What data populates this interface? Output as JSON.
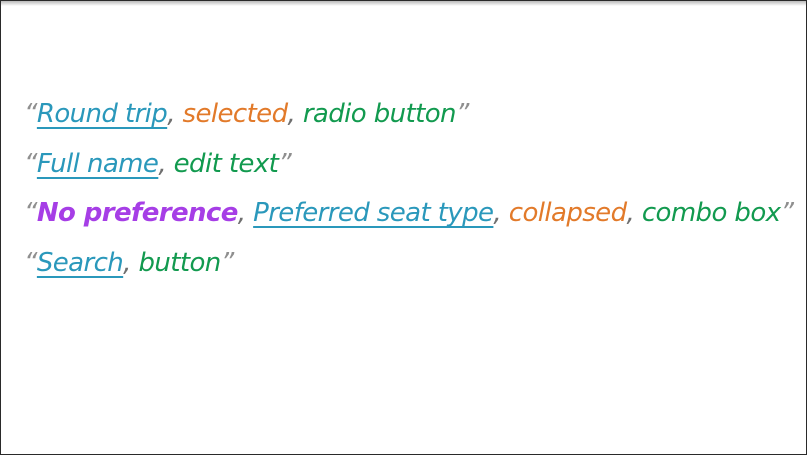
{
  "quote_open": "“",
  "quote_close": "”",
  "separator": ",",
  "colors": {
    "quote": "#8f8f8f",
    "name": "#2a98bb",
    "value": "#a63ee6",
    "state": "#e27a2a",
    "role": "#129a4f"
  },
  "announcements": [
    {
      "name": "Round trip",
      "state": "selected",
      "role": "radio button"
    },
    {
      "name": "Full name",
      "role": "edit text"
    },
    {
      "value": "No preference",
      "name": "Preferred seat type",
      "state": "collapsed",
      "role": "combo box"
    },
    {
      "name": "Search",
      "role": "button"
    }
  ]
}
